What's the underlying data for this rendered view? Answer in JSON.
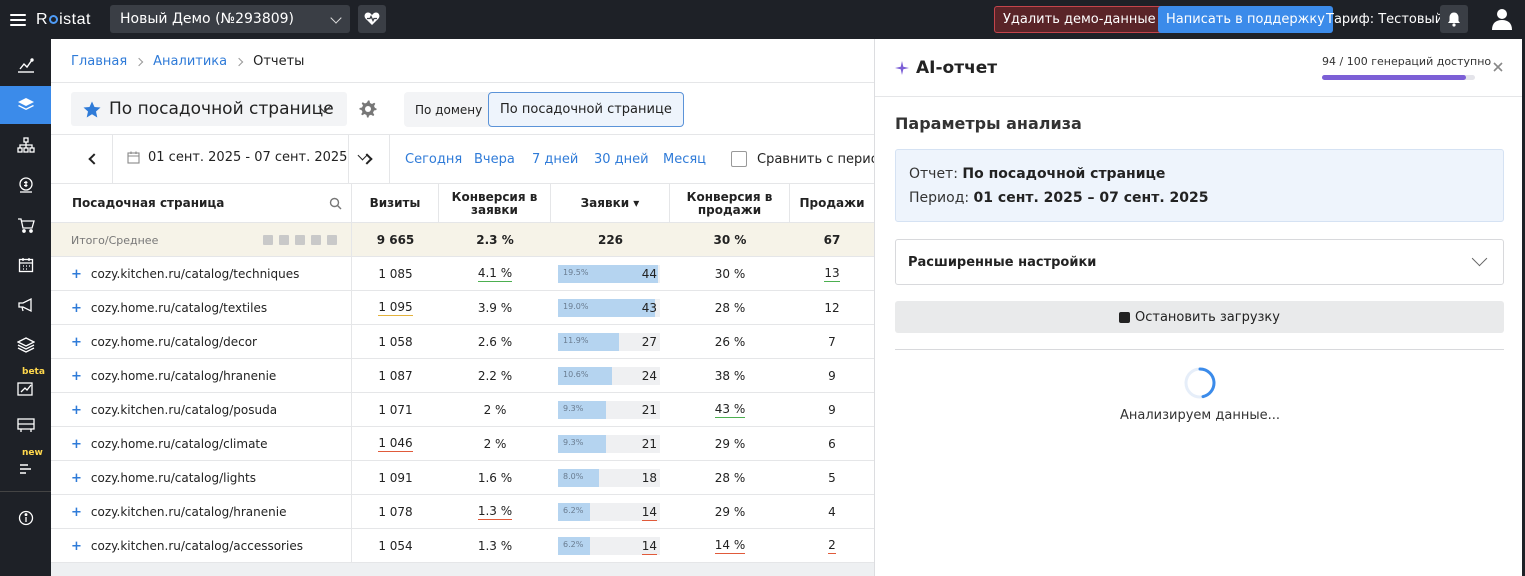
{
  "topbar": {
    "logo": "Roistat",
    "project": "Новый Демо (№293809)",
    "delete_demo": "Удалить демо-данные",
    "support": "Написать в поддержку",
    "tariff": "Тариф: Тестовый"
  },
  "sidebar": {
    "items": [
      "analytics-icon",
      "layers-icon",
      "sitemap-icon",
      "money-icon",
      "cart-icon",
      "calendar-icon",
      "megaphone-icon",
      "stack-icon",
      "growth-icon",
      "dashboard-icon",
      "list-icon",
      "info-icon"
    ],
    "badge_beta": "beta",
    "badge_new": "new"
  },
  "breadcrumbs": {
    "home": "Главная",
    "analytics": "Аналитика",
    "current": "Отчеты"
  },
  "report": {
    "selected": "По посадочной странице",
    "tab_domain": "По домену",
    "tab_landing": "По посадочной странице"
  },
  "datebar": {
    "range": "01 сент. 2025 - 07 сент. 2025",
    "today": "Сегодня",
    "yesterday": "Вчера",
    "days7": "7 дней",
    "days30": "30 дней",
    "month": "Месяц",
    "compare": "Сравнить с периодом"
  },
  "table": {
    "headers": {
      "page": "Посадочная страница",
      "visits": "Визиты",
      "conv_leads": "Конверсия в заявки",
      "leads": "Заявки ▾",
      "conv_sales": "Конверсия в продажи",
      "sales": "Продажи"
    },
    "total": {
      "label": "Итого/Среднее",
      "visits": "9 665",
      "conv_leads": "2.3 %",
      "leads": "226",
      "conv_sales": "30 %",
      "sales": "67"
    },
    "rows": [
      {
        "page": "cozy.kitchen.ru/catalog/techniques",
        "visits": "1 085",
        "conv_leads": "4.1 %",
        "leads_pct": "19.5%",
        "leads": "44",
        "leads_share": 0.195,
        "conv_sales": "30 %",
        "sales": "13"
      },
      {
        "page": "cozy.home.ru/catalog/textiles",
        "visits": "1 095",
        "conv_leads": "3.9 %",
        "leads_pct": "19.0%",
        "leads": "43",
        "leads_share": 0.19,
        "conv_sales": "28 %",
        "sales": "12"
      },
      {
        "page": "cozy.home.ru/catalog/decor",
        "visits": "1 058",
        "conv_leads": "2.6 %",
        "leads_pct": "11.9%",
        "leads": "27",
        "leads_share": 0.119,
        "conv_sales": "26 %",
        "sales": "7"
      },
      {
        "page": "cozy.home.ru/catalog/hranenie",
        "visits": "1 087",
        "conv_leads": "2.2 %",
        "leads_pct": "10.6%",
        "leads": "24",
        "leads_share": 0.106,
        "conv_sales": "38 %",
        "sales": "9"
      },
      {
        "page": "cozy.kitchen.ru/catalog/posuda",
        "visits": "1 071",
        "conv_leads": "2 %",
        "leads_pct": "9.3%",
        "leads": "21",
        "leads_share": 0.093,
        "conv_sales": "43 %",
        "sales": "9"
      },
      {
        "page": "cozy.home.ru/catalog/climate",
        "visits": "1 046",
        "conv_leads": "2 %",
        "leads_pct": "9.3%",
        "leads": "21",
        "leads_share": 0.093,
        "conv_sales": "29 %",
        "sales": "6"
      },
      {
        "page": "cozy.home.ru/catalog/lights",
        "visits": "1 091",
        "conv_leads": "1.6 %",
        "leads_pct": "8.0%",
        "leads": "18",
        "leads_share": 0.08,
        "conv_sales": "28 %",
        "sales": "5"
      },
      {
        "page": "cozy.kitchen.ru/catalog/hranenie",
        "visits": "1 078",
        "conv_leads": "1.3 %",
        "leads_pct": "6.2%",
        "leads": "14",
        "leads_share": 0.062,
        "conv_sales": "29 %",
        "sales": "4"
      },
      {
        "page": "cozy.kitchen.ru/catalog/accessories",
        "visits": "1 054",
        "conv_leads": "1.3 %",
        "leads_pct": "6.2%",
        "leads": "14",
        "leads_share": 0.062,
        "conv_sales": "14 %",
        "sales": "2"
      }
    ]
  },
  "ai_panel": {
    "title": "AI-отчет",
    "generations": "94 / 100",
    "generations_suffix": "генераций доступно",
    "generations_used": 0.94,
    "params_title": "Параметры анализа",
    "report_label": "Отчет:",
    "report_value": "По посадочной странице",
    "period_label": "Период:",
    "period_value": "01 сент. 2025 – 07 сент. 2025",
    "advanced": "Расширенные настройки",
    "stop": "Остановить загрузку",
    "analyzing": "Анализируем данные..."
  },
  "colors": {
    "accent": "#3b8bea",
    "sidebar": "#1e2127",
    "ai_purple": "#7c5fd6"
  }
}
